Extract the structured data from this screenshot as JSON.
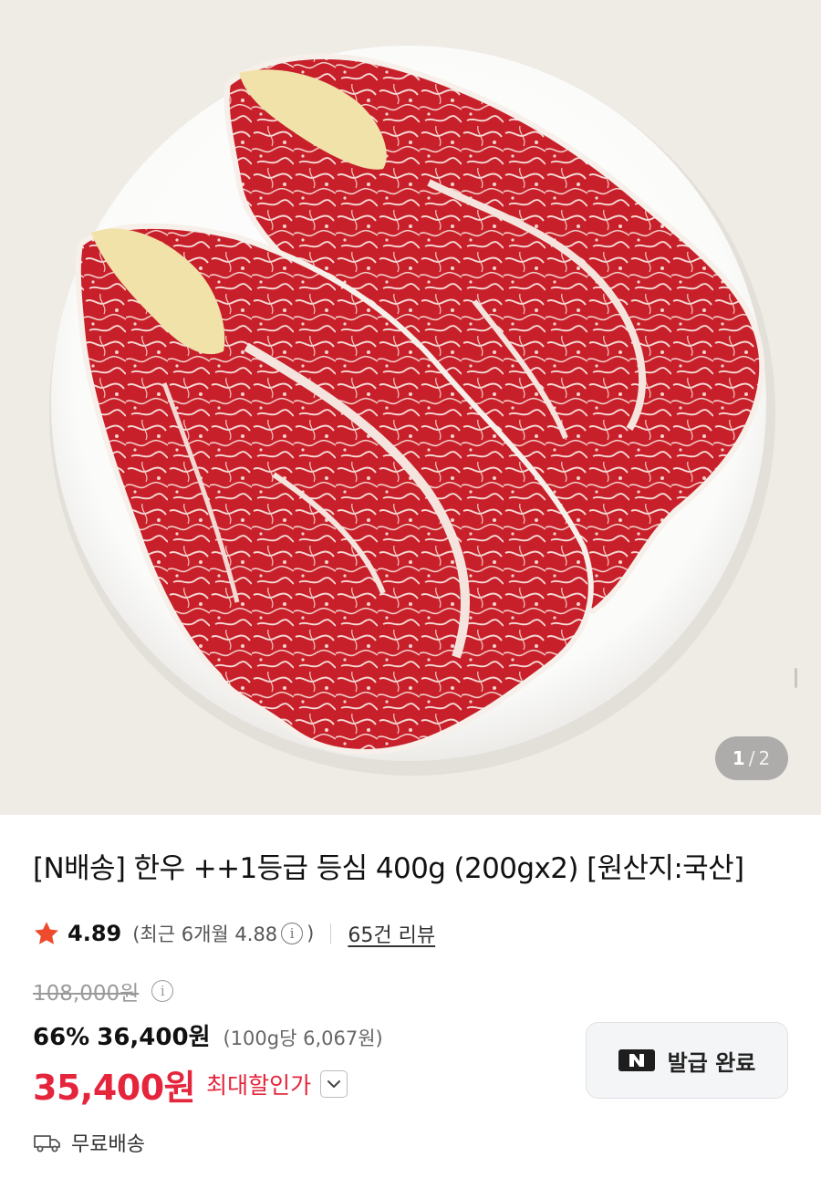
{
  "gallery": {
    "current_page": "1",
    "separator": "/",
    "total_pages": "2"
  },
  "product": {
    "title": "[N배송] 한우 ++1등급 등심 400g (200gx2) [원산지:국산]",
    "rating": {
      "score": "4.89",
      "recent_open": "(최근 6개월 4.88",
      "info_glyph": "i",
      "recent_close": ")",
      "reviews_link": "65건 리뷰"
    },
    "pricing": {
      "original_price": "108,000원",
      "discount_rate": "66%",
      "sale_price": "36,400원",
      "unit_price": "(100g당 6,067원)",
      "final_price": "35,400원",
      "max_discount_label": "최대할인가"
    },
    "coupon": {
      "label": "발급 완료",
      "icon": "naver-n-icon"
    },
    "shipping": {
      "label": "무료배송",
      "icon": "truck-icon"
    }
  },
  "colors": {
    "accent_red": "#e5253b",
    "rating_star": "#ee4a2c"
  }
}
